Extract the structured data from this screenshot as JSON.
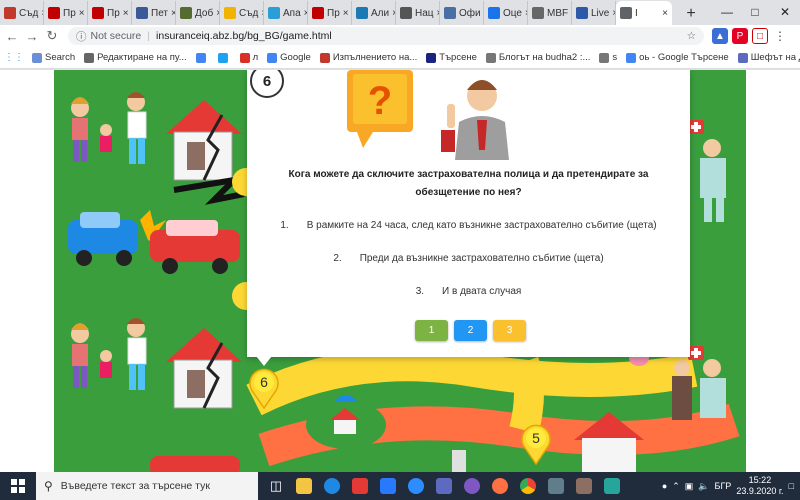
{
  "tabs": [
    {
      "label": "Съд",
      "color": "#c0392b"
    },
    {
      "label": "Пр",
      "color": "#c00000"
    },
    {
      "label": "Пр",
      "color": "#c00000"
    },
    {
      "label": "Пет",
      "color": "#3b5998"
    },
    {
      "label": "Доб",
      "color": "#556b2f"
    },
    {
      "label": "Съд",
      "color": "#f0b400"
    },
    {
      "label": "Апа",
      "color": "#2a9fd6"
    },
    {
      "label": "Пр",
      "color": "#c00000"
    },
    {
      "label": "Али",
      "color": "#1b7ab3"
    },
    {
      "label": "Нац",
      "color": "#555555"
    },
    {
      "label": "Офи",
      "color": "#4a6fa5"
    },
    {
      "label": "Оце",
      "color": "#1a73e8"
    },
    {
      "label": "MBF",
      "color": "#666666"
    },
    {
      "label": "Live",
      "color": "#2d5aa8"
    },
    {
      "label": "I",
      "color": "#5f6368",
      "active": true
    }
  ],
  "toolbar": {
    "security_label": "Not secure",
    "url": "insuranceiq.abz.bg/bg_BG/game.html"
  },
  "bookmarks": [
    {
      "label": "Search",
      "color": "#6b8fd6"
    },
    {
      "label": "Редактиране на пу...",
      "color": "#666666"
    },
    {
      "label": "",
      "color": "#4285f4"
    },
    {
      "label": "",
      "color": "#1da1f2"
    },
    {
      "label": "л",
      "color": "#d93025"
    },
    {
      "label": "Google",
      "color": "#4285f4"
    },
    {
      "label": "Изпълнението на...",
      "color": "#c0392b"
    },
    {
      "label": "Търсене",
      "color": "#1a237e"
    },
    {
      "label": "Блогът на budha2 :...",
      "color": "#777777"
    },
    {
      "label": "ѕ",
      "color": "#777777"
    },
    {
      "label": "оь - Google Търсене",
      "color": "#4285f4"
    },
    {
      "label": "Шефът на ДАИ изб...",
      "color": "#5c6bc0"
    }
  ],
  "quiz": {
    "number": "6",
    "question": "Кога можете да сключите застрахователна полица и да претендирате за обезщетение по нея?",
    "answers": [
      {
        "num": "1.",
        "text": "В рамките на  24 часа, след като възникне застрахователно събитие (щета)"
      },
      {
        "num": "2.",
        "text": "Преди да възникне застрахователно събитие (щета)"
      },
      {
        "num": "3.",
        "text": "И в двата случая"
      }
    ],
    "buttons": [
      {
        "label": "1",
        "color": "#7cb342"
      },
      {
        "label": "2",
        "color": "#2196f3"
      },
      {
        "label": "3",
        "color": "#fbc02d"
      }
    ]
  },
  "board": {
    "markers": [
      "6",
      "5"
    ]
  },
  "taskbar": {
    "search_placeholder": "Въведете текст за търсене тук",
    "language": "БГР",
    "time": "15:22",
    "date": "23.9.2020 г."
  }
}
